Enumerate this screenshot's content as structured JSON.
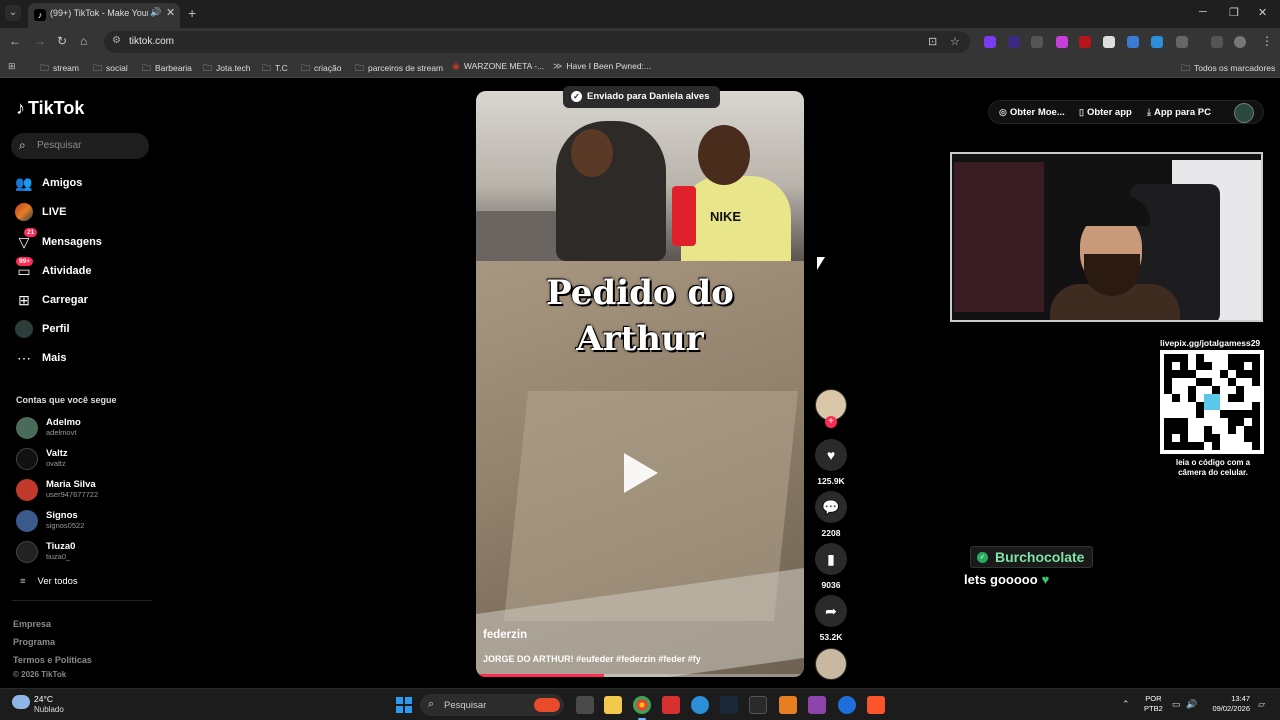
{
  "browser": {
    "tab_title": "(99+) TikTok - Make Your Day",
    "url": "tiktok.com",
    "bookmarks": [
      "stream",
      "social",
      "Barbearia",
      "Jota.tech",
      "T.C",
      "criação",
      "parceiros de stream",
      "WARZONE META -...",
      "Have I Been Pwned:...",
      "Todos os marcadores"
    ]
  },
  "tiktok": {
    "logo": "TikTok",
    "search_placeholder": "Pesquisar",
    "nav": [
      {
        "label": "Amigos",
        "icon": "friends-icon"
      },
      {
        "label": "LIVE",
        "icon": "live-icon"
      },
      {
        "label": "Mensagens",
        "icon": "messages-icon",
        "badge": "21"
      },
      {
        "label": "Atividade",
        "icon": "activity-icon",
        "badge": "99+"
      },
      {
        "label": "Carregar",
        "icon": "upload-icon"
      },
      {
        "label": "Perfil",
        "icon": "profile-icon"
      },
      {
        "label": "Mais",
        "icon": "more-icon"
      }
    ],
    "following_title": "Contas que você segue",
    "accounts": [
      {
        "name": "Adelmo",
        "handle": "adelmovt",
        "color": "#4a6b5a"
      },
      {
        "name": "Valtz",
        "handle": "ovaltz",
        "color": "#111111"
      },
      {
        "name": "Maria Silva",
        "handle": "user947677722",
        "color": "#c0392b"
      },
      {
        "name": "Signos",
        "handle": "signos0522",
        "color": "#3a5a8c"
      },
      {
        "name": "Tiuza0",
        "handle": "tiuza0_",
        "color": "#222222"
      }
    ],
    "see_all": "Ver todos",
    "footer": {
      "links": [
        "Empresa",
        "Programa",
        "Termos e Políticas"
      ],
      "copyright": "© 2026 TikTok"
    },
    "toast": "Enviado para Daniela alves",
    "video": {
      "overlay_line1": "Pedido do",
      "overlay_line2": "Arthur",
      "shirt_text": "NIKE",
      "username": "federzin",
      "caption": "JORGE DO ARTHUR! #eufeder #federzin #feder #fy",
      "progress": 0.39
    },
    "actions": {
      "likes": "125.9K",
      "comments": "2208",
      "saves": "9036",
      "shares": "53.2K"
    },
    "header_right": {
      "coins": "Obter Moe...",
      "get_app": "Obter app",
      "pc_app": "App para PC"
    }
  },
  "stream": {
    "qr_url": "livepix.gg/jotalgamess29",
    "qr_note": "leia o código com a câmera do celular.",
    "chat_user": "Burchocolate",
    "chat_message": "lets gooooo"
  },
  "taskbar": {
    "temp": "24°C",
    "condition": "Nublado",
    "search": "Pesquisar",
    "lang1": "POR",
    "lang2": "PTB2",
    "time": "13:47",
    "date": "09/02/2026"
  }
}
